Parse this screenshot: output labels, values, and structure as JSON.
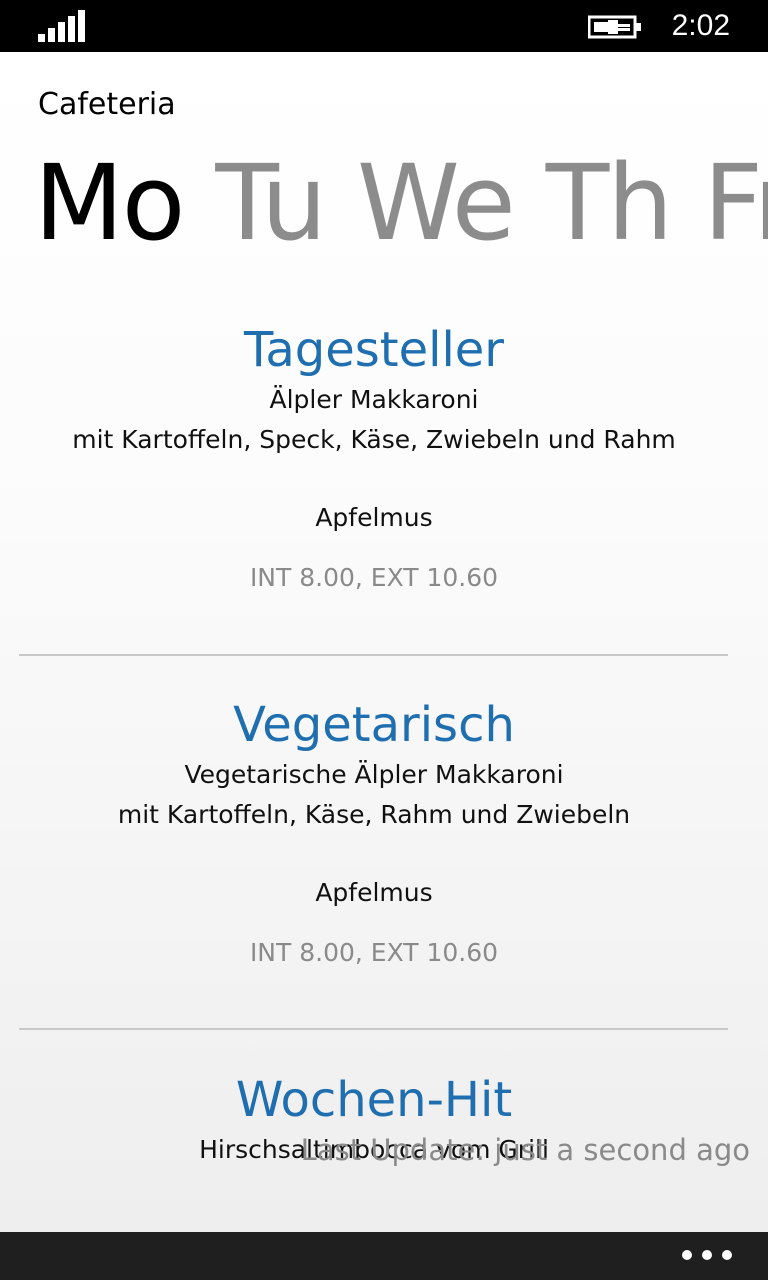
{
  "status_bar": {
    "time": "2:02",
    "signal_icon": "signal-strength-icon",
    "battery_icon": "battery-charging-icon"
  },
  "app": {
    "title": "Cafeteria"
  },
  "pivot": {
    "days": [
      "Mo",
      "Tu",
      "We",
      "Th",
      "Fr"
    ],
    "selected": "Mo"
  },
  "menu": [
    {
      "title": "Tagesteller",
      "dish": "Älpler Makkaroni",
      "description": "mit Kartoffeln, Speck, Käse, Zwiebeln und Rahm",
      "side": "Apfelmus",
      "price": "INT 8.00, EXT 10.60"
    },
    {
      "title": "Vegetarisch",
      "dish": "Vegetarische Älpler Makkaroni",
      "description": "mit Kartoffeln, Käse, Rahm und Zwiebeln",
      "side": "Apfelmus",
      "price": "INT 8.00, EXT 10.60"
    },
    {
      "title": "Wochen-Hit",
      "dish": "Hirschsaltimbocca vom Grill"
    }
  ],
  "footer": {
    "last_update": "Last Update: just a second ago"
  },
  "app_bar": {
    "more_icon": "ellipsis-icon"
  },
  "colors": {
    "accent": "#1f6fb0",
    "inactive_pivot": "#8c8c8c",
    "price": "#8a8a8a",
    "status_bar": "#000000",
    "app_bar": "#1f1f1f"
  }
}
